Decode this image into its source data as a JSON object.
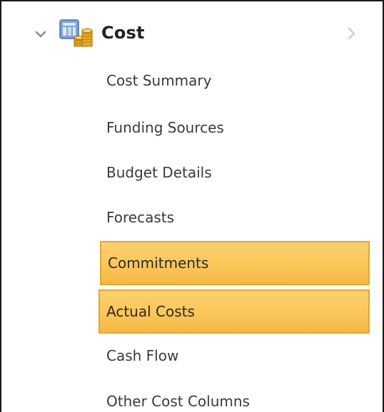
{
  "section": {
    "title": "Cost",
    "expanded": true,
    "icon": "cost-coins-icon",
    "expand_icon": "chevron-down-icon",
    "forward_icon": "chevron-right-icon"
  },
  "nav_items": [
    {
      "label": "Cost Summary",
      "highlighted": false
    },
    {
      "label": "Funding Sources",
      "highlighted": false
    },
    {
      "label": "Budget Details",
      "highlighted": false
    },
    {
      "label": "Forecasts",
      "highlighted": false
    },
    {
      "label": "Commitments",
      "highlighted": true
    },
    {
      "label": "Actual Costs",
      "highlighted": true
    },
    {
      "label": "Cash Flow",
      "highlighted": false
    },
    {
      "label": "Other Cost Columns",
      "highlighted": false
    }
  ],
  "colors": {
    "highlight_fill": "#fbc65a",
    "highlight_border": "#e6a531",
    "text": "#3a3a3a",
    "frame": "#1a1a1a"
  }
}
